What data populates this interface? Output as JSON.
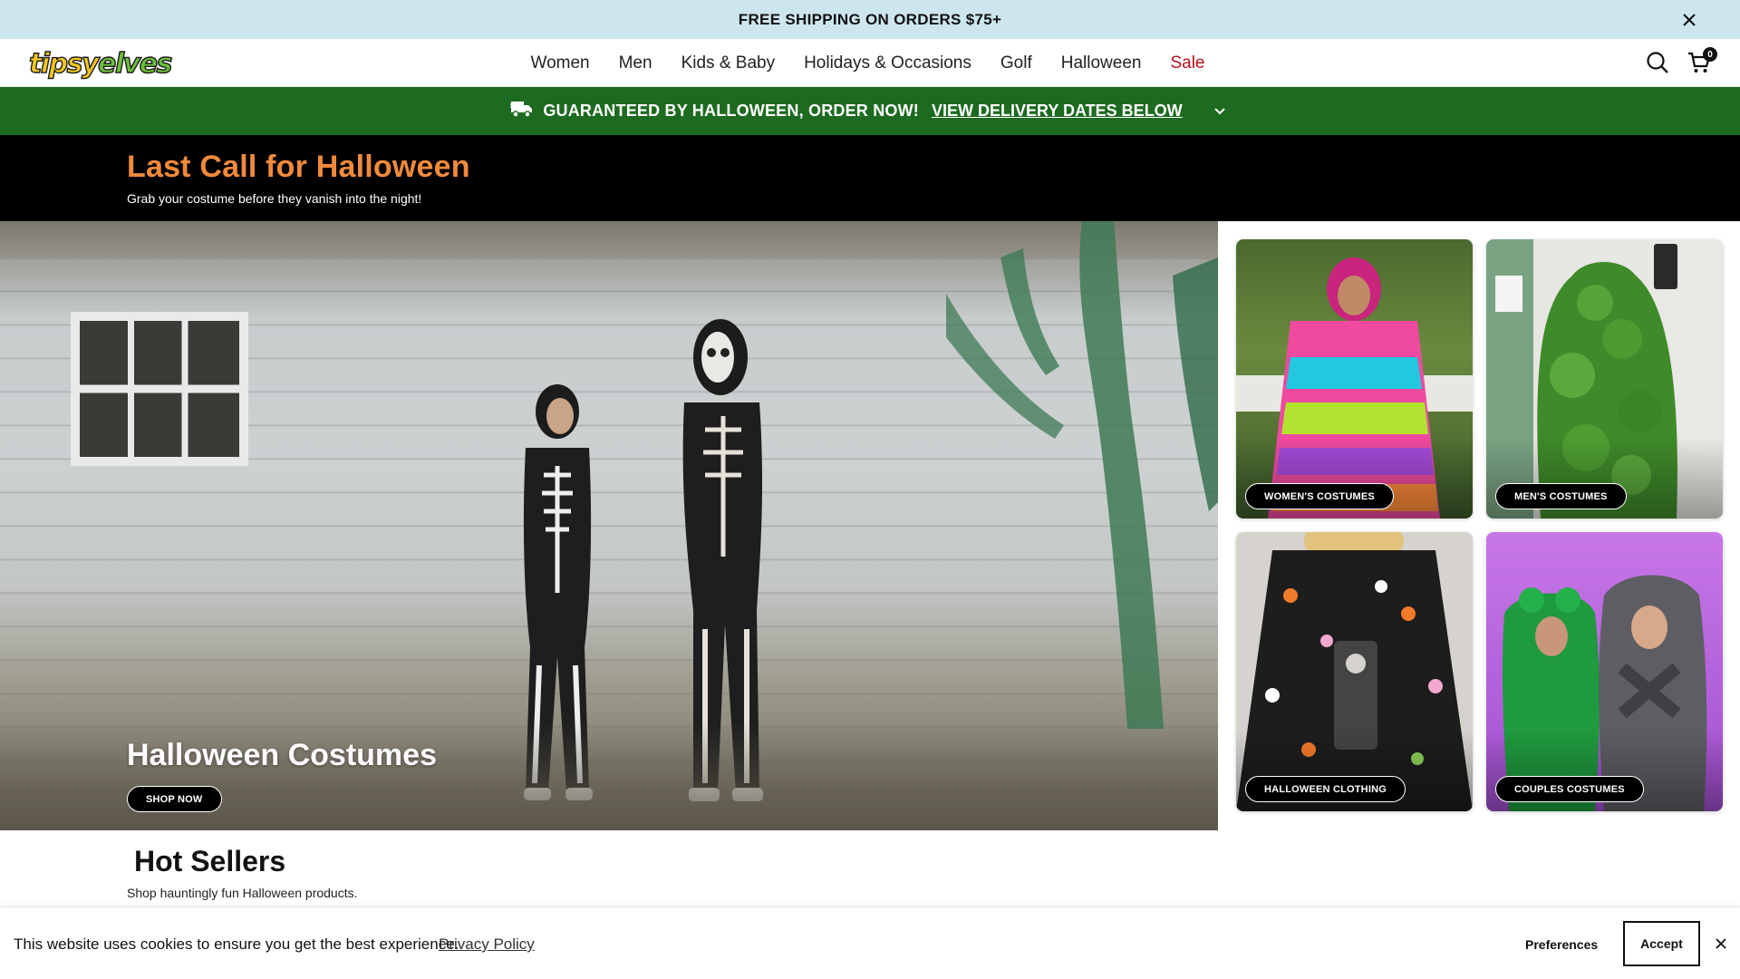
{
  "announcement": {
    "text": "FREE SHIPPING ON ORDERS $75+",
    "close_icon": "close-icon"
  },
  "header": {
    "logo_part1": "tipsy",
    "logo_part2": "elves",
    "nav": [
      "Women",
      "Men",
      "Kids & Baby",
      "Holidays & Occasions",
      "Golf",
      "Halloween",
      "Sale"
    ],
    "cart_count": "0",
    "icons": [
      "search-icon",
      "cart-icon"
    ]
  },
  "delivery_bar": {
    "icon": "truck-icon",
    "text": "GUARANTEED BY HALLOWEEN, ORDER NOW!",
    "link": "VIEW DELIVERY DATES BELOW",
    "chevron_icon": "chevron-down-icon"
  },
  "promo": {
    "title": "Last Call for Halloween",
    "subtitle": "Grab your costume before they vanish into the night!"
  },
  "hero": {
    "title": "Halloween Costumes",
    "button": "SHOP NOW"
  },
  "tiles": [
    {
      "label": "WOMEN'S COSTUMES"
    },
    {
      "label": "MEN'S COSTUMES"
    },
    {
      "label": "HALLOWEEN CLOTHING"
    },
    {
      "label": "COUPLES COSTUMES"
    }
  ],
  "hot_sellers": {
    "title": "Hot Sellers",
    "subtitle": "Shop hauntingly fun Halloween products."
  },
  "cookie": {
    "text": "This website uses cookies to ensure you get the best experience.",
    "link": "Privacy Policy",
    "preferences": "Preferences",
    "accept": "Accept",
    "close_icon": "close-icon"
  },
  "colors": {
    "announcement_bg": "#cde6ee",
    "delivery_bg": "#1d6b20",
    "promo_title": "#f08a3c",
    "sale": "#b5121b"
  }
}
